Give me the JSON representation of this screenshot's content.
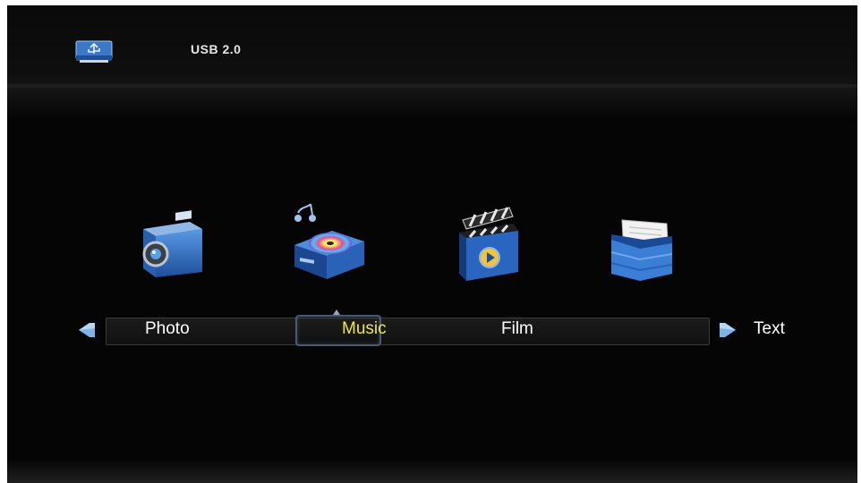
{
  "header": {
    "source_label": "USB 2.0",
    "source_icon": "usb-drive-icon"
  },
  "menu": {
    "items": [
      {
        "label": "Photo",
        "icon": "camera-icon",
        "selected": false
      },
      {
        "label": "Music",
        "icon": "music-disc-icon",
        "selected": true
      },
      {
        "label": "Film",
        "icon": "clapperboard-icon",
        "selected": false
      },
      {
        "label": "Text",
        "icon": "folder-document-icon",
        "selected": false
      }
    ],
    "nav_left_icon": "left-arrow-icon",
    "nav_right_icon": "right-arrow-icon"
  },
  "colors": {
    "background": "#050505",
    "label_text": "#ffffff",
    "selected_text": "#f2e64a",
    "icon_blue": "#2f6fc6",
    "arrow_blue": "#7fb3e6"
  }
}
